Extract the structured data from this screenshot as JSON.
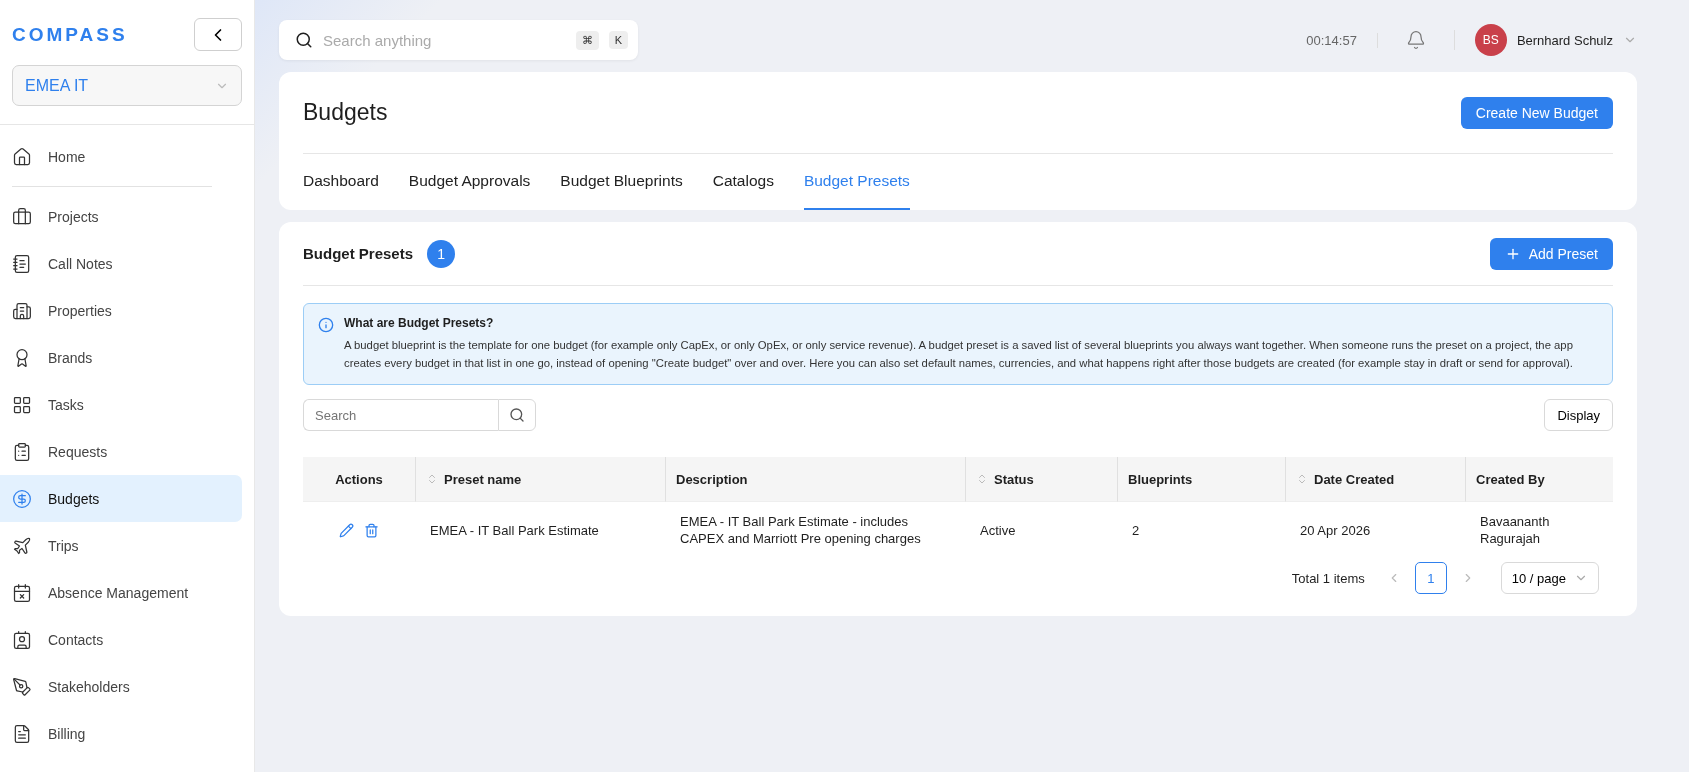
{
  "sidebar": {
    "logo": "COMPASS",
    "workspace": "EMEA IT",
    "items": [
      {
        "label": "Home",
        "selected": false
      },
      {
        "label": "Projects",
        "selected": false
      },
      {
        "label": "Call Notes",
        "selected": false
      },
      {
        "label": "Properties",
        "selected": false
      },
      {
        "label": "Brands",
        "selected": false
      },
      {
        "label": "Tasks",
        "selected": false
      },
      {
        "label": "Requests",
        "selected": false
      },
      {
        "label": "Budgets",
        "selected": true
      },
      {
        "label": "Trips",
        "selected": false
      },
      {
        "label": "Absence Management",
        "selected": false
      },
      {
        "label": "Contacts",
        "selected": false
      },
      {
        "label": "Stakeholders",
        "selected": false
      },
      {
        "label": "Billing",
        "selected": false
      }
    ]
  },
  "topbar": {
    "search": {
      "placeholder": "Search anything",
      "keys": [
        "⌘",
        "K"
      ]
    },
    "timer": "00:14:57",
    "user": {
      "initials": "BS",
      "name": "Bernhard Schulz"
    }
  },
  "page": {
    "title": "Budgets",
    "create_button": "Create New Budget",
    "tabs": [
      {
        "label": "Dashboard",
        "selected": false
      },
      {
        "label": "Budget Approvals",
        "selected": false
      },
      {
        "label": "Budget Blueprints",
        "selected": false
      },
      {
        "label": "Catalogs",
        "selected": false
      },
      {
        "label": "Budget Presets",
        "selected": true
      }
    ]
  },
  "presets": {
    "title": "Budget Presets",
    "count": "1",
    "add_button": "Add Preset",
    "info": {
      "title": "What are Budget Presets?",
      "text": "A budget blueprint is the template for one budget (for example only CapEx, or only OpEx, or only service revenue). A budget preset is a saved list of several blueprints you always want together. When someone runs the preset on a project, the app creates every budget in that list in one go, instead of opening \"Create budget\" over and over. Here you can also set default names, currencies, and what happens right after those budgets are created (for example stay in draft or send for approval)."
    },
    "search": {
      "placeholder": "Search"
    },
    "display_button": "Display",
    "table": {
      "columns": [
        {
          "label": "Actions",
          "sortable": false
        },
        {
          "label": "Preset name",
          "sortable": true
        },
        {
          "label": "Description",
          "sortable": false
        },
        {
          "label": "Status",
          "sortable": true
        },
        {
          "label": "Blueprints",
          "sortable": false
        },
        {
          "label": "Date Created",
          "sortable": true
        },
        {
          "label": "Created By",
          "sortable": false
        }
      ],
      "rows": [
        {
          "cells": [
            "",
            "EMEA - IT Ball Park Estimate",
            "EMEA - IT Ball Park Estimate - includes CAPEX and Marriott Pre opening charges",
            "Active",
            "2",
            "20 Apr 2026",
            "Bavaananth Ragurajah"
          ]
        }
      ]
    },
    "pagination": {
      "total": "Total 1 items",
      "pages": [
        {
          "label": "1",
          "selected": true
        }
      ],
      "page_size": "10 / page"
    }
  }
}
